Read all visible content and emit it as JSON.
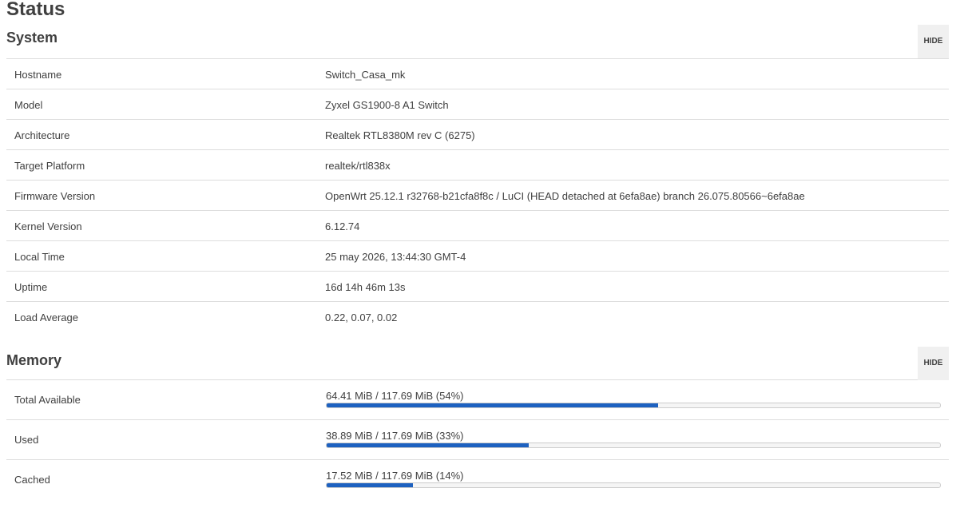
{
  "page": {
    "title": "Status"
  },
  "system": {
    "title": "System",
    "hide_label": "HIDE",
    "rows": [
      {
        "label": "Hostname",
        "value": "Switch_Casa_mk"
      },
      {
        "label": "Model",
        "value": "Zyxel GS1900-8 A1 Switch"
      },
      {
        "label": "Architecture",
        "value": "Realtek RTL8380M rev C (6275)"
      },
      {
        "label": "Target Platform",
        "value": "realtek/rtl838x"
      },
      {
        "label": "Firmware Version",
        "value": "OpenWrt 25.12.1 r32768-b21cfa8f8c / LuCI (HEAD detached at 6efa8ae) branch 26.075.80566~6efa8ae"
      },
      {
        "label": "Kernel Version",
        "value": "6.12.74"
      },
      {
        "label": "Local Time",
        "value": "25 may 2026, 13:44:30 GMT-4"
      },
      {
        "label": "Uptime",
        "value": "16d 14h 46m 13s"
      },
      {
        "label": "Load Average",
        "value": "0.22, 0.07, 0.02"
      }
    ]
  },
  "memory": {
    "title": "Memory",
    "hide_label": "HIDE",
    "bar_color": "#1d61c0",
    "rows": [
      {
        "label": "Total Available",
        "text": "64.41 MiB / 117.69 MiB (54%)",
        "percent": 54
      },
      {
        "label": "Used",
        "text": "38.89 MiB / 117.69 MiB (33%)",
        "percent": 33
      },
      {
        "label": "Cached",
        "text": "17.52 MiB / 117.69 MiB (14%)",
        "percent": 14
      }
    ]
  }
}
